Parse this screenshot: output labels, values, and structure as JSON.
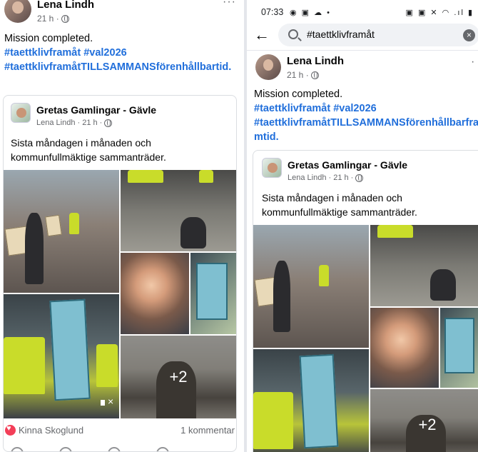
{
  "left": {
    "author": "Lena Lindh",
    "time": "21 h ·",
    "more": "···",
    "post_line1": "Mission completed.",
    "hashtags_line1": "#taettklivframåt #val2026",
    "hashtags_line2": "#taettklivframåtTILLSAMMANSförenhållbartid.",
    "group_name": "Gretas Gamlingar - Gävle",
    "shared_meta": "Lena Lindh · 21 h ·",
    "shared_text": "Sista måndagen i månaden och kommunfullmäktige sammanträder.",
    "more_photos": "+2",
    "reactor": "Kinna Skoglund",
    "comments": "1 kommentar"
  },
  "right": {
    "status_time": "07:33",
    "status_left_icons": "◉ ▣ ☁ •",
    "status_right_icons": "▣ ▣ ✕ ◠ .ıl ▮",
    "search_query": "#taettklivframåt",
    "clear": "×",
    "author": "Lena Lindh",
    "time": "21 h ·",
    "more": "·",
    "post_line1": "Mission completed.",
    "hashtags_line1": "#taettklivframåt #val2026",
    "hashtags_line2": "#taettklivframåtTILLSAMMANSförenhållbarfra",
    "hashtags_line3": "mtid.",
    "group_name": "Gretas Gamlingar - Gävle",
    "shared_meta": "Lena Lindh · 21 h ·",
    "shared_text": "Sista måndagen i månaden och kommunfullmäktige sammanträder.",
    "more_photos": "+2"
  },
  "colors": {
    "hashtag": "#216fdb",
    "secondary_text": "#65676b",
    "reaction_heart": "#f33e58",
    "vest": "#c9dc2a"
  },
  "icons": [
    "globe-icon",
    "more-icon",
    "back-arrow-icon",
    "search-icon",
    "clear-icon",
    "heart-icon",
    "mute-icon"
  ]
}
